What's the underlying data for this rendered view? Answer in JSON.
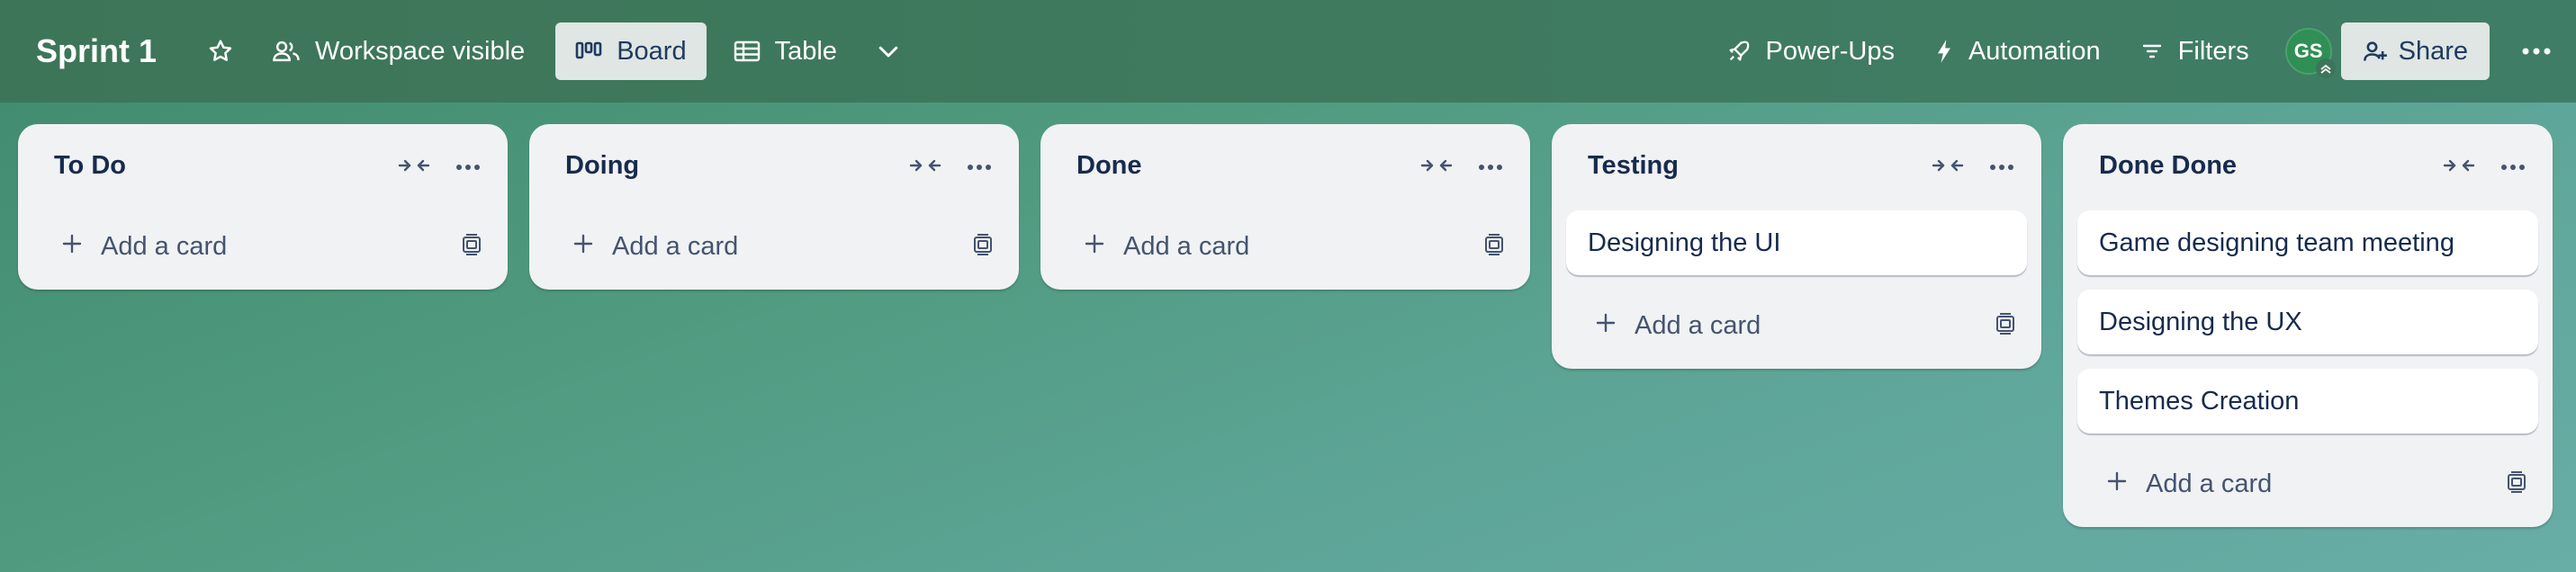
{
  "header": {
    "board_title": "Sprint 1",
    "visibility_label": "Workspace visible",
    "view_tabs": [
      {
        "label": "Board",
        "icon": "board-icon",
        "active": true
      },
      {
        "label": "Table",
        "icon": "table-icon",
        "active": false
      }
    ],
    "powerups_label": "Power-Ups",
    "automation_label": "Automation",
    "filters_label": "Filters",
    "avatar_initials": "GS",
    "share_label": "Share"
  },
  "lists": [
    {
      "title": "To Do",
      "cards": [],
      "add_label": "Add a card"
    },
    {
      "title": "Doing",
      "cards": [],
      "add_label": "Add a card"
    },
    {
      "title": "Done",
      "cards": [],
      "add_label": "Add a card"
    },
    {
      "title": "Testing",
      "cards": [
        "Designing the UI"
      ],
      "add_label": "Add a card"
    },
    {
      "title": "Done Done",
      "cards": [
        "Game designing team meeting",
        "Designing the UX",
        "Themes Creation"
      ],
      "add_label": "Add a card"
    }
  ],
  "colors": {
    "header_bg": "#3d7558",
    "board_bg": "#5fa69a",
    "list_bg": "#f1f2f4",
    "card_text": "#172b4d",
    "avatar_bg": "#2f8f55"
  }
}
